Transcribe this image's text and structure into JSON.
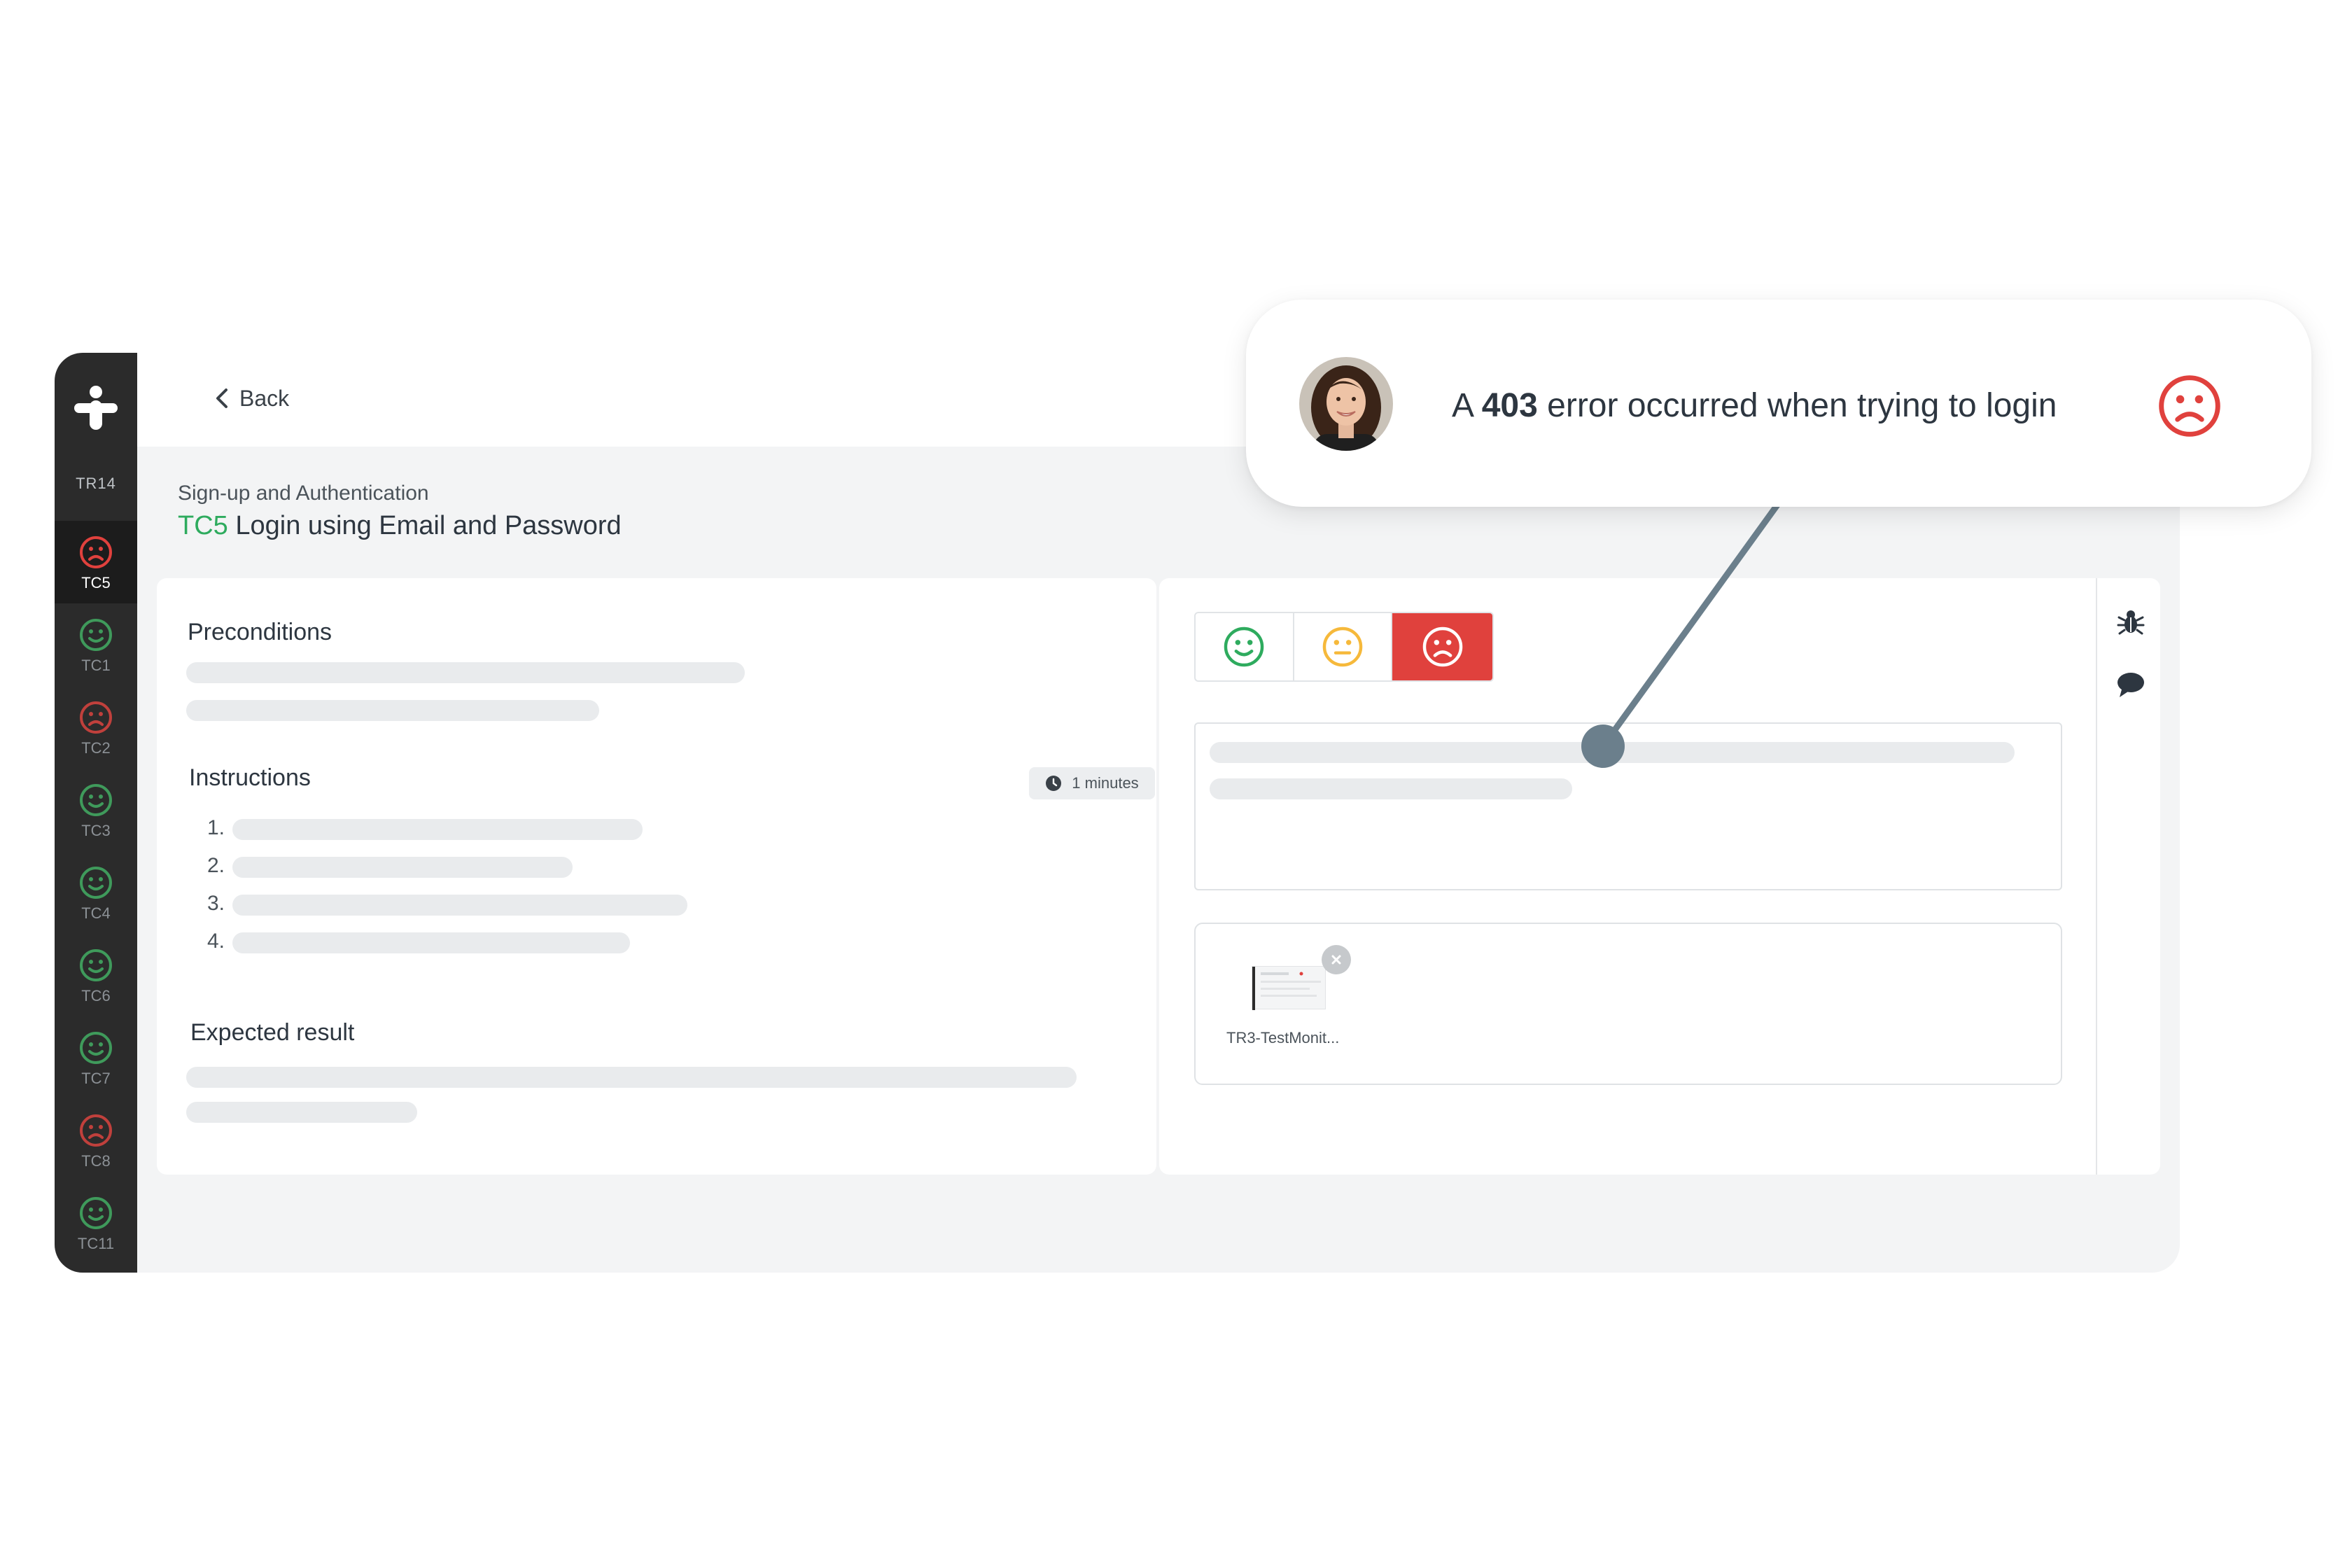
{
  "app": {
    "back_label": "Back",
    "run_label": "TR14",
    "suite_name": "Sign-up and Authentication",
    "test_code": "TC5",
    "test_title": " Login using Email and Password"
  },
  "sidebar": {
    "items": [
      {
        "label": "TC5",
        "status": "failed",
        "active": true
      },
      {
        "label": "TC1",
        "status": "passed"
      },
      {
        "label": "TC2",
        "status": "failed"
      },
      {
        "label": "TC3",
        "status": "passed"
      },
      {
        "label": "TC4",
        "status": "passed"
      },
      {
        "label": "TC6",
        "status": "passed"
      },
      {
        "label": "TC7",
        "status": "passed"
      },
      {
        "label": "TC8",
        "status": "failed"
      },
      {
        "label": "TC11",
        "status": "passed"
      }
    ]
  },
  "details": {
    "preconditions_heading": "Preconditions",
    "instructions_heading": "Instructions",
    "duration_badge": "1 minutes",
    "step_numbers": [
      "1.",
      "2.",
      "3.",
      "4."
    ],
    "expected_heading": "Expected result"
  },
  "result": {
    "status_options": [
      "passed",
      "blocked",
      "failed"
    ],
    "selected_status": "failed",
    "attachment_name": "TR3-TestMonit..."
  },
  "tools": {
    "icons": [
      "bug-icon",
      "comment-icon"
    ]
  },
  "comment_bubble": {
    "text_before": "A ",
    "text_bold": "403",
    "text_after": " error occurred when trying to login",
    "status": "failed"
  },
  "colors": {
    "passed": "#2eab5e",
    "blocked": "#f6b93b",
    "failed": "#e0413d",
    "sidebar_passed": "#3f9a5b",
    "sidebar_failed": "#c0403c",
    "connector": "#6b7f8c"
  }
}
